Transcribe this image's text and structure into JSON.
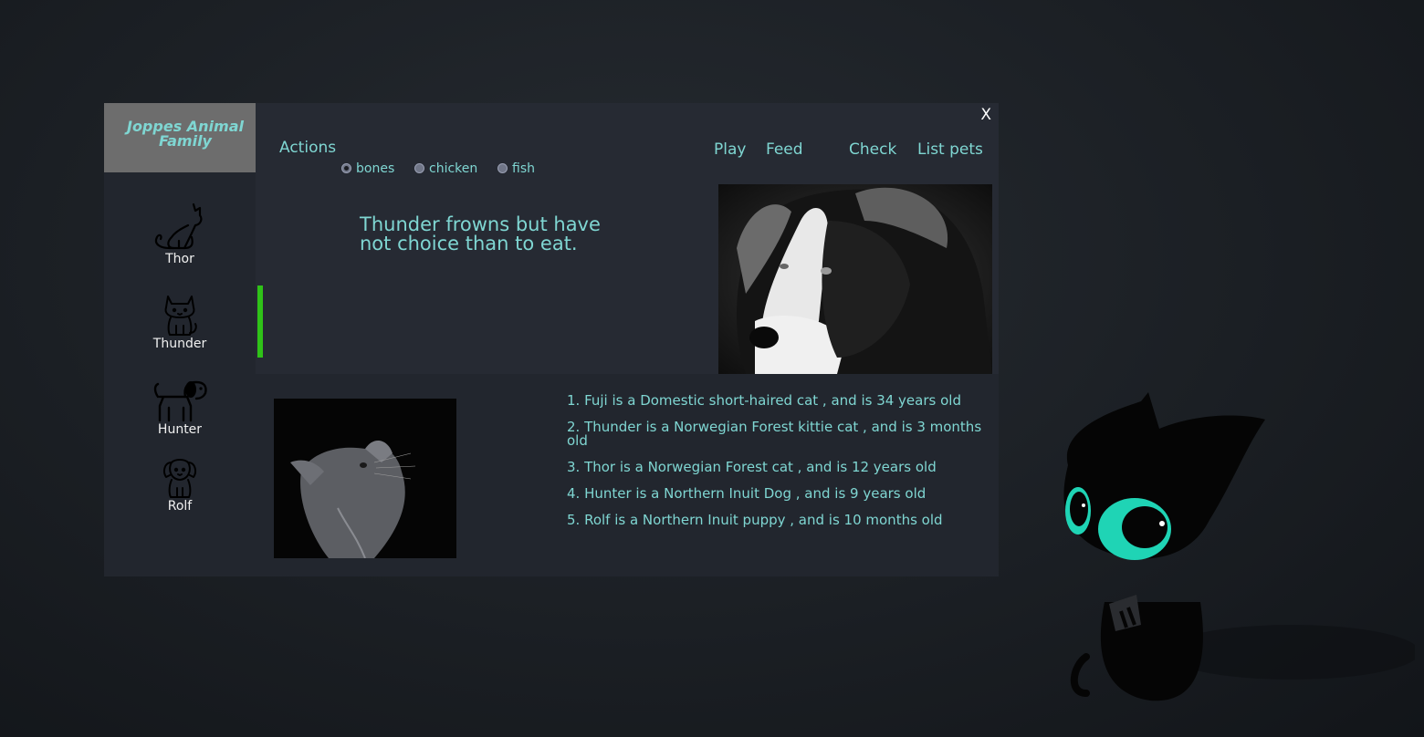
{
  "window": {
    "brand_line1": "Joppes Animal",
    "brand_line2": "Family",
    "close_label": "X"
  },
  "sidebar": {
    "pets": [
      {
        "name": "Thor",
        "icon": "sitting-cat-icon"
      },
      {
        "name": "Thunder",
        "icon": "kitten-icon"
      },
      {
        "name": "Hunter",
        "icon": "dog-icon"
      },
      {
        "name": "Rolf",
        "icon": "puppy-icon"
      }
    ]
  },
  "actions": {
    "label": "Actions",
    "menu": [
      "Play",
      "Feed",
      "Check",
      "List pets"
    ],
    "food_options": [
      {
        "label": "bones",
        "selected": true
      },
      {
        "label": "chicken",
        "selected": false
      },
      {
        "label": "fish",
        "selected": false
      }
    ]
  },
  "message": "Thunder frowns but have not choice than to eat.",
  "status_bar_color": "#2fc218",
  "accent_color": "#7fd6d2",
  "pet_list": [
    "1. Fuji is a Domestic short-haired cat , and is 34 years old",
    "2. Thunder is a Norwegian Forest kittie cat , and is 3 months old",
    "3. Thor is a Norwegian Forest cat , and is 12 years old",
    "4. Hunter is a Northern Inuit Dog , and is 9 years old",
    "5. Rolf is a Northern Inuit puppy , and is 10 months old"
  ]
}
